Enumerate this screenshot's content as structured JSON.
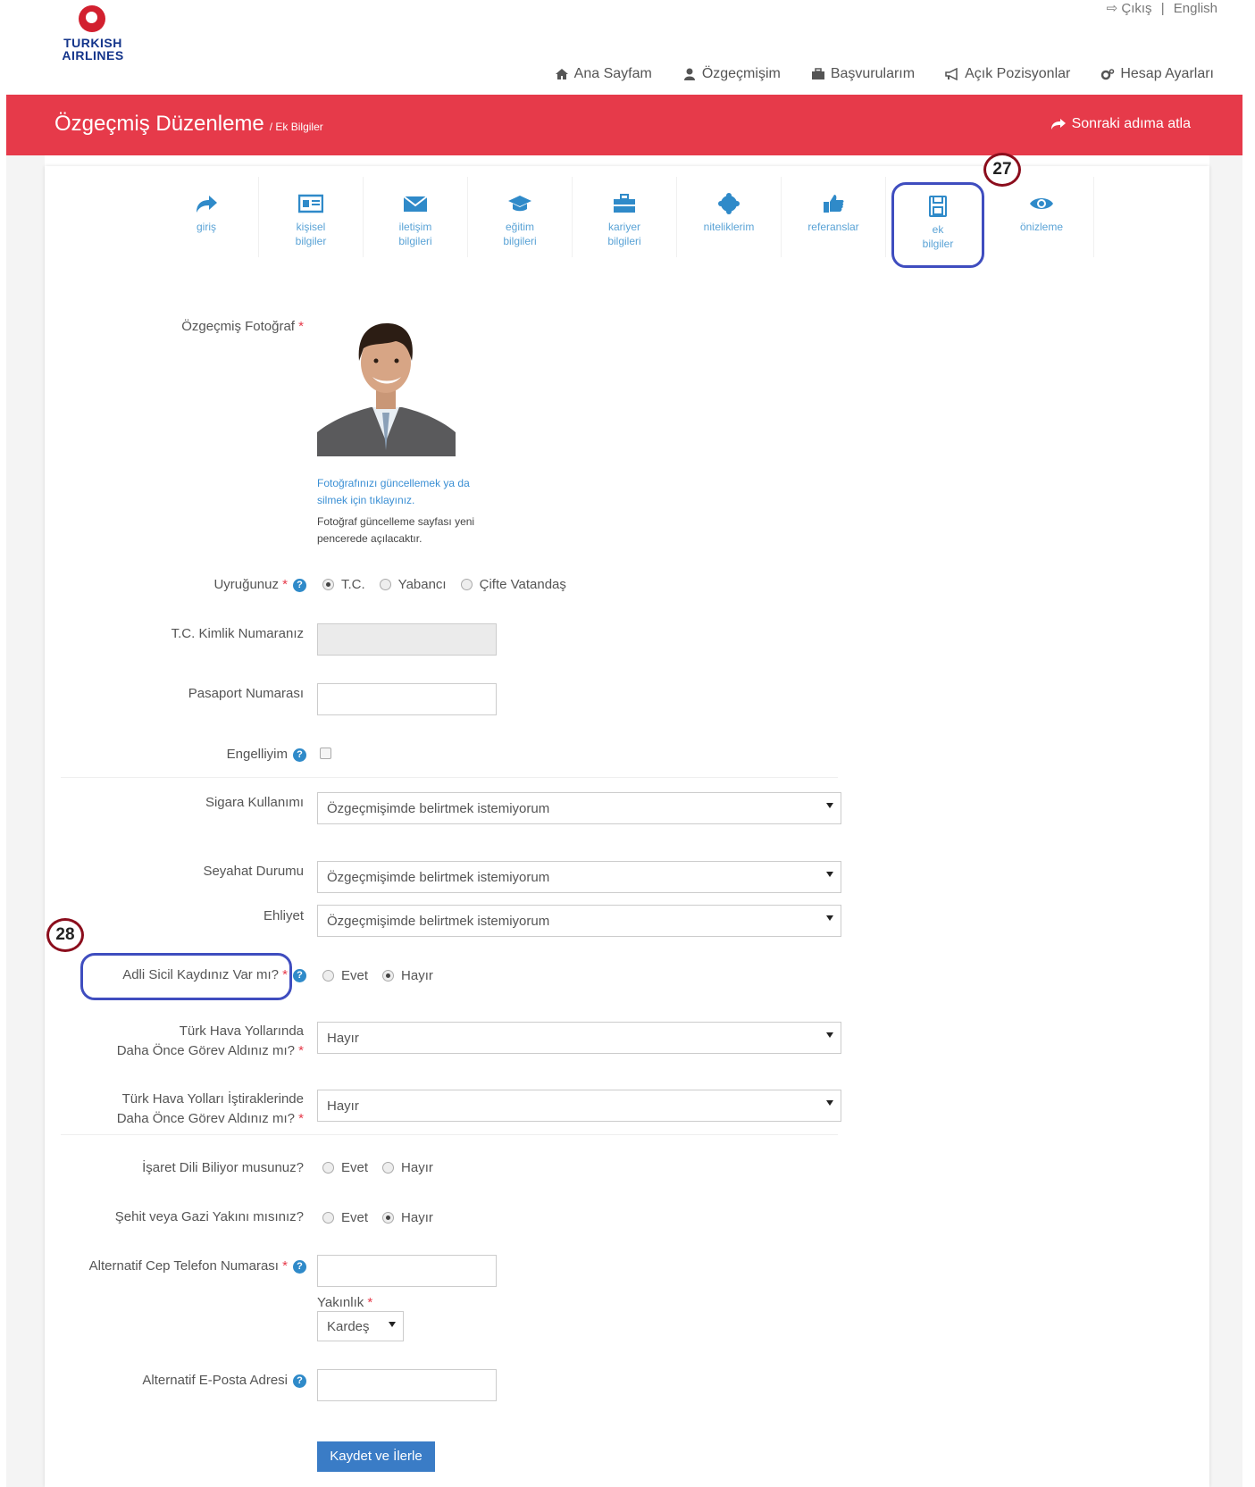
{
  "brand": {
    "logo_line1": "TURKISH",
    "logo_line2": "AIRLINES",
    "color": "#d2202f"
  },
  "toplinks": {
    "logout": "Çıkış",
    "separator": "|",
    "language": "English"
  },
  "nav": [
    {
      "label": "Ana Sayfam",
      "icon": "home-icon"
    },
    {
      "label": "Özgeçmişim",
      "icon": "user-icon"
    },
    {
      "label": "Başvurularım",
      "icon": "briefcase-icon"
    },
    {
      "label": "Açık Pozisyonlar",
      "icon": "megaphone-icon"
    },
    {
      "label": "Hesap Ayarları",
      "icon": "gears-icon"
    }
  ],
  "header": {
    "title": "Özgeçmiş Düzenleme",
    "subtitle": "/ Ek Bilgiler",
    "next": "Sonraki adıma atla",
    "accent": "#e63a4a"
  },
  "steps": [
    {
      "line1": "giriş",
      "line2": "",
      "icon": "share-icon"
    },
    {
      "line1": "kişisel",
      "line2": "bilgiler",
      "icon": "id-card-icon"
    },
    {
      "line1": "iletişim",
      "line2": "bilgileri",
      "icon": "envelope-icon"
    },
    {
      "line1": "eğitim",
      "line2": "bilgileri",
      "icon": "graduation-cap-icon"
    },
    {
      "line1": "kariyer",
      "line2": "bilgileri",
      "icon": "briefcase-icon"
    },
    {
      "line1": "niteliklerim",
      "line2": "",
      "icon": "certificate-icon"
    },
    {
      "line1": "referanslar",
      "line2": "",
      "icon": "thumbs-up-icon"
    },
    {
      "line1": "ek",
      "line2": "bilgiler",
      "icon": "floppy-icon"
    },
    {
      "line1": "önizleme",
      "line2": "",
      "icon": "eye-icon"
    }
  ],
  "badges": {
    "b27": "27",
    "b28": "28"
  },
  "form": {
    "photo_label": "Özgeçmiş Fotoğraf",
    "req": "*",
    "photo_link": [
      "Fotoğrafınızı güncellemek ya da",
      "silmek için tıklayınız."
    ],
    "photo_note": [
      "Fotoğraf güncelleme sayfası yeni",
      "pencerede açılacaktır."
    ],
    "nationality_label": "Uyruğunuz",
    "nationality_opts": [
      "T.C.",
      "Yabancı",
      "Çifte Vatandaş"
    ],
    "tc_label": "T.C. Kimlik Numaranız",
    "passport_label": "Pasaport Numarası",
    "disabled_label": "Engelliyim",
    "smoking_label": "Sigara Kullanımı",
    "smoking_value": "Özgeçmişimde belirtmek istemiyorum",
    "travel_label": "Seyahat Durumu",
    "travel_value": "Özgeçmişimde belirtmek istemiyorum",
    "license_label": "Ehliyet",
    "license_value": "Özgeçmişimde belirtmek istemiyorum",
    "criminal_label": "Adli Sicil Kaydınız Var mı?",
    "yes": "Evet",
    "no": "Hayır",
    "thy_worked_label1": "Türk Hava Yollarında",
    "thy_worked_label2": "Daha Önce Görev Aldınız mı?",
    "thy_worked_value": "Hayır",
    "thy_sub_label1": "Türk Hava Yolları İştiraklerinde",
    "thy_sub_label2": "Daha Önce Görev Aldınız mı?",
    "thy_sub_value": "Hayır",
    "sign_label": "İşaret Dili Biliyor musunuz?",
    "martyr_label": "Şehit veya Gazi Yakını mısınız?",
    "alt_phone_label": "Alternatif Cep Telefon Numarası",
    "relation_label": "Yakınlık",
    "relation_value": "Kardeş",
    "alt_email_label": "Alternatif E-Posta Adresi",
    "submit": "Kaydet ve İlerle"
  }
}
